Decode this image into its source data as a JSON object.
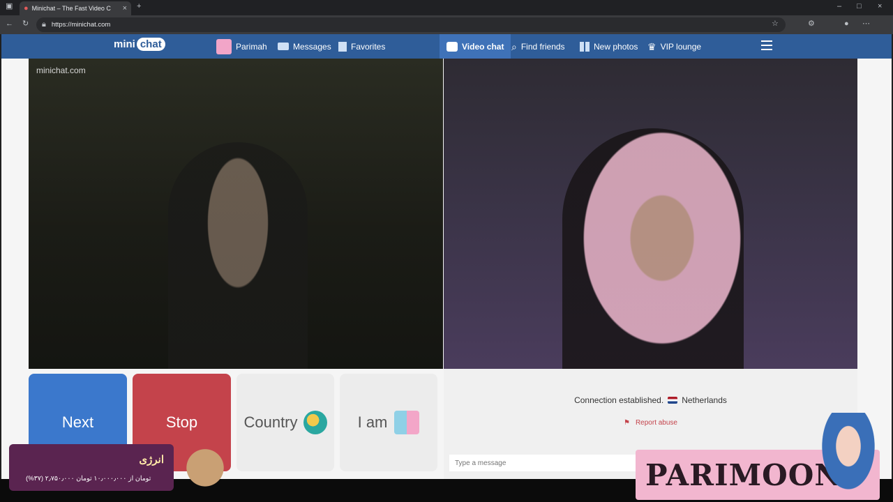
{
  "browser": {
    "tab_title": "Minichat – The Fast Video C",
    "url": "https://minichat.com"
  },
  "site": {
    "logo_left": "mini",
    "logo_right": "chat",
    "nav": {
      "profile": "Parimah",
      "messages": "Messages",
      "favorites": "Favorites",
      "video_chat": "Video chat",
      "find_friends": "Find friends",
      "new_photos": "New photos",
      "vip_lounge": "VIP lounge"
    },
    "watermark": "minichat.com",
    "buttons": {
      "next": "Next",
      "stop": "Stop",
      "country": "Country",
      "iam": "I am"
    },
    "chat": {
      "status_prefix": "Connection established.",
      "country": "Netherlands",
      "report": "Report abuse",
      "placeholder": "Type a message"
    }
  },
  "overlays": {
    "promo_title": "انرژی",
    "promo_text": "(%۳۷) ۲٫۷۵۰٫۰۰۰ تومان از ۱۰٫۰۰۰٫۰۰۰ تومان",
    "brand": "PARIMOON"
  },
  "colors": {
    "nav_bg": "#2f5d99",
    "next": "#3b78cc",
    "stop": "#c4434b"
  }
}
